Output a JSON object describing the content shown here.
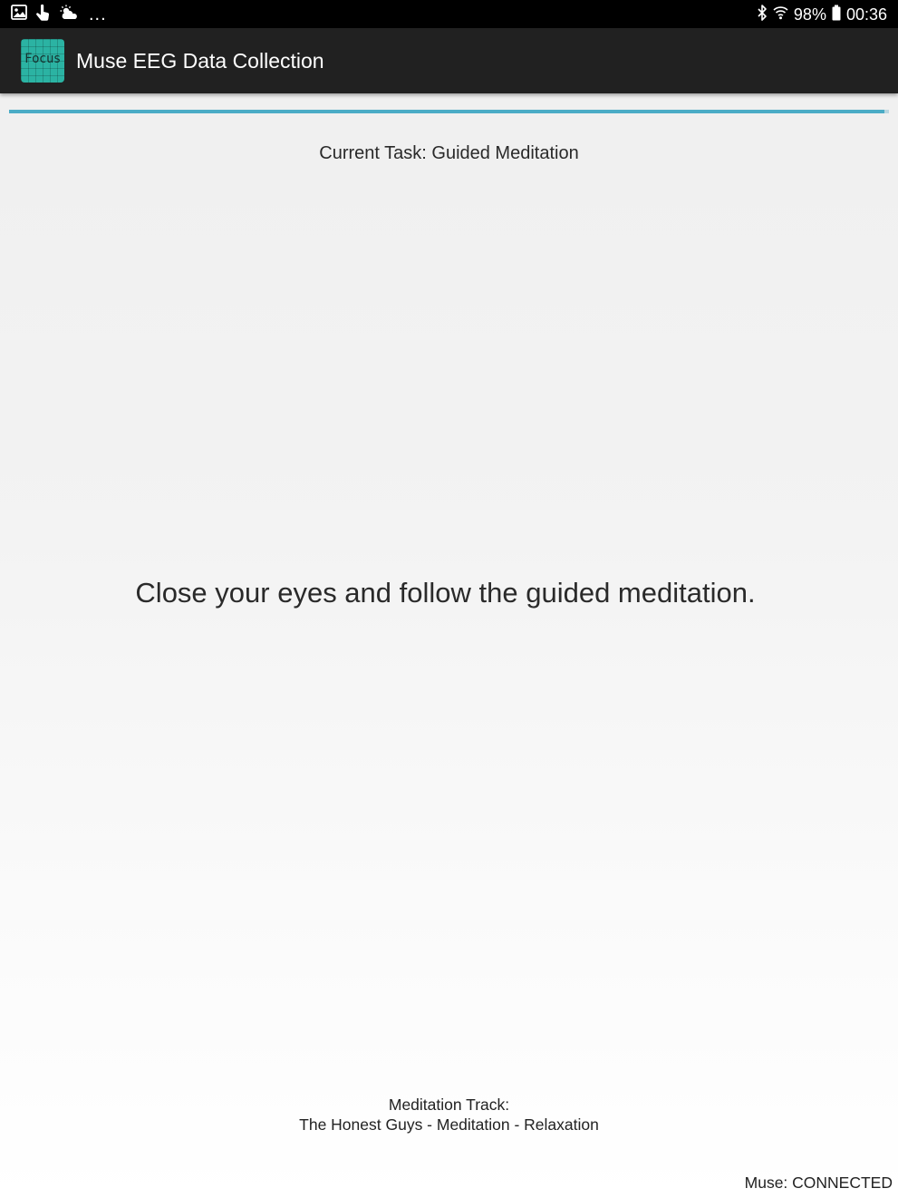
{
  "status_bar": {
    "left_icons": [
      "image-icon",
      "hand-touch-icon",
      "weather-cloud-sun-icon"
    ],
    "overflow": "...",
    "battery_percent": "98%",
    "time": "00:36",
    "right_icons": [
      "bluetooth-icon",
      "wifi-icon",
      "battery-icon"
    ]
  },
  "app_bar": {
    "logo_text": "Focus",
    "title": "Muse EEG Data Collection",
    "background_color": "#212121",
    "logo_color": "#2bb3a3"
  },
  "progress": {
    "value": 0.995,
    "color": "#4bacc6"
  },
  "main": {
    "current_task": "Current Task: Guided Meditation",
    "instruction": "Close your eyes and follow the guided meditation.",
    "track_label": "Meditation Track:",
    "track_name": "The Honest Guys - Meditation - Relaxation",
    "muse_status": "Muse: CONNECTED"
  }
}
